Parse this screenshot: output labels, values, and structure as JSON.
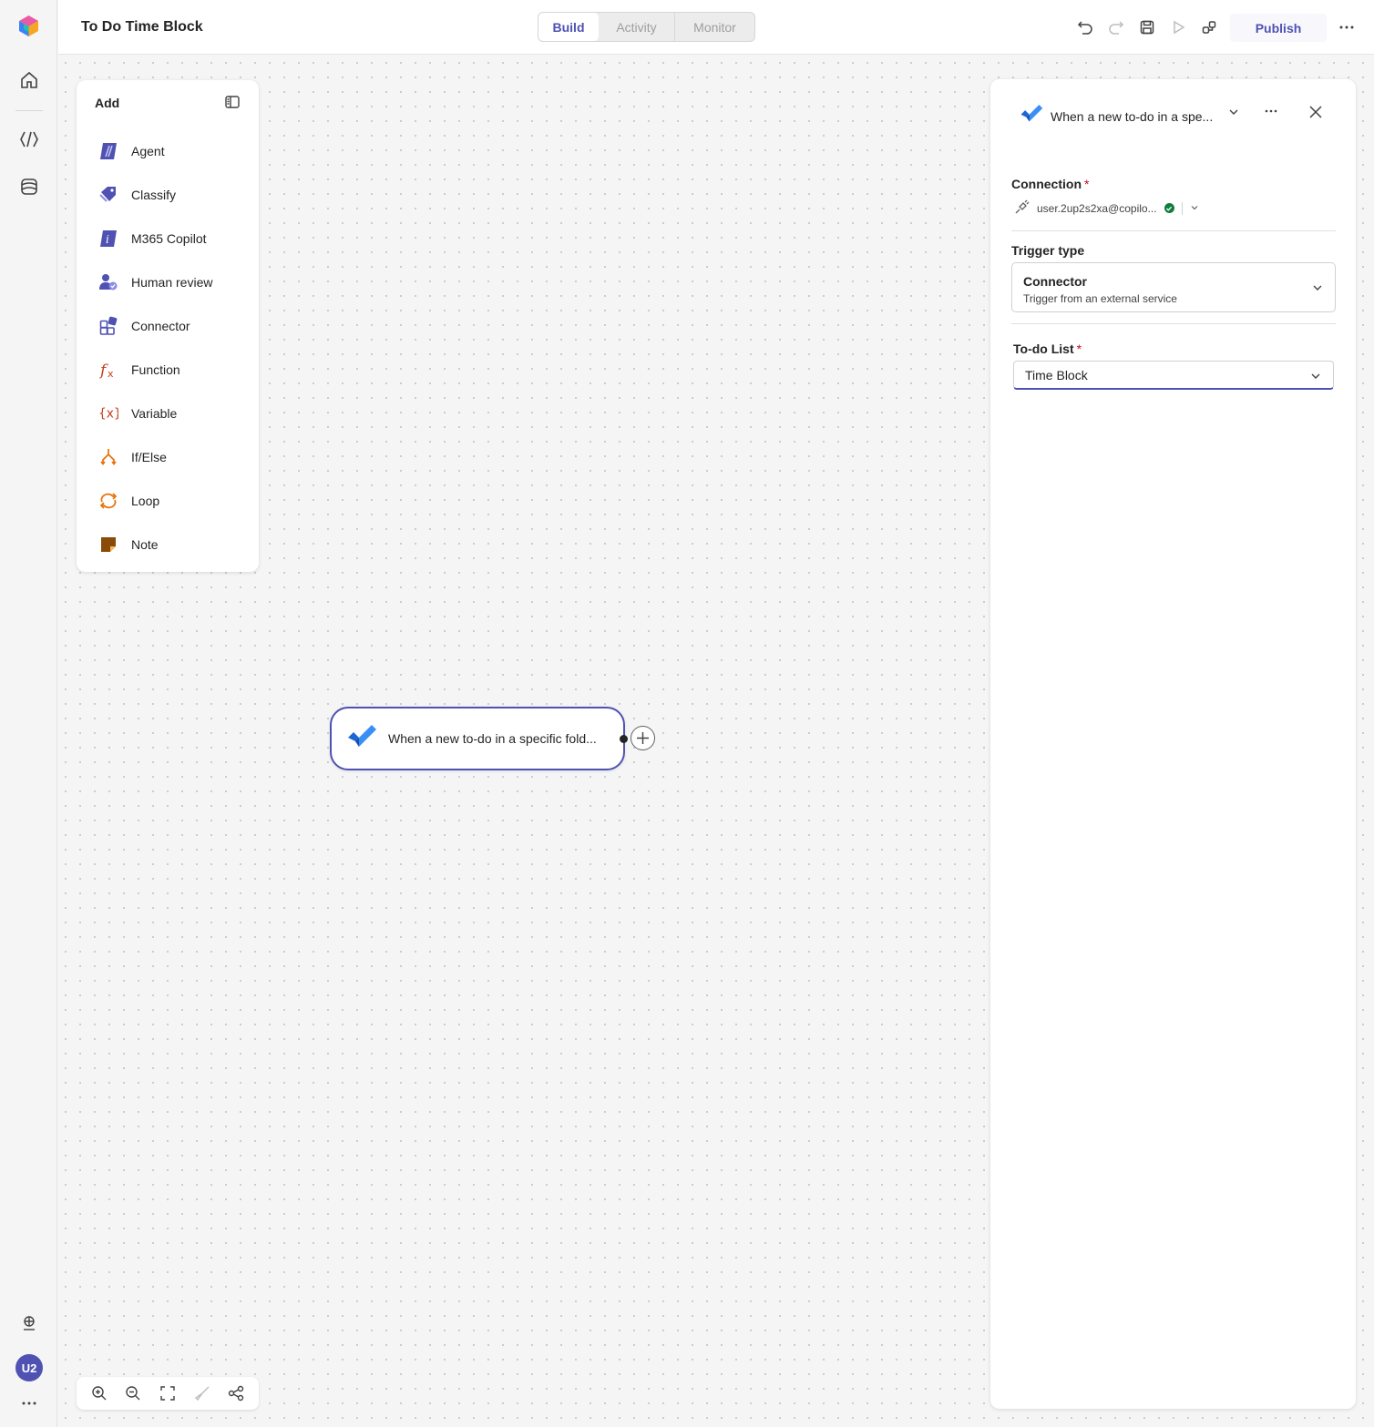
{
  "app": {
    "title": "To Do Time Block",
    "tabs": [
      {
        "label": "Build",
        "active": true
      },
      {
        "label": "Activity",
        "active": false
      },
      {
        "label": "Monitor",
        "active": false
      }
    ],
    "publish_label": "Publish",
    "user_initials": "U2",
    "accent_color": "#4f52b2"
  },
  "toolbar_icons": [
    "undo-icon",
    "redo-icon",
    "save-icon",
    "play-icon",
    "flow-checker-icon",
    "more-icon"
  ],
  "add_panel": {
    "header": "Add",
    "items": [
      {
        "label": "Agent",
        "icon": "agent-icon"
      },
      {
        "label": "Classify",
        "icon": "classify-icon"
      },
      {
        "label": "M365 Copilot",
        "icon": "copilot-icon"
      },
      {
        "label": "Human review",
        "icon": "human-review-icon"
      },
      {
        "label": "Connector",
        "icon": "connector-icon"
      },
      {
        "label": "Function",
        "icon": "function-icon"
      },
      {
        "label": "Variable",
        "icon": "variable-icon"
      },
      {
        "label": "If/Else",
        "icon": "if-else-icon"
      },
      {
        "label": "Loop",
        "icon": "loop-icon"
      },
      {
        "label": "Note",
        "icon": "note-icon"
      }
    ]
  },
  "canvas": {
    "node_label": "When a new to-do in a specific fold..."
  },
  "details_panel": {
    "title": "When a new to-do in a spe...",
    "connection_label": "Connection",
    "connection_value": "user.2up2s2xa@copilo...",
    "trigger_type_label": "Trigger type",
    "trigger_type_value": "Connector",
    "trigger_type_desc": "Trigger from an external service",
    "todo_list_label": "To-do List",
    "todo_list_value": "Time Block",
    "required_mark": "*"
  }
}
